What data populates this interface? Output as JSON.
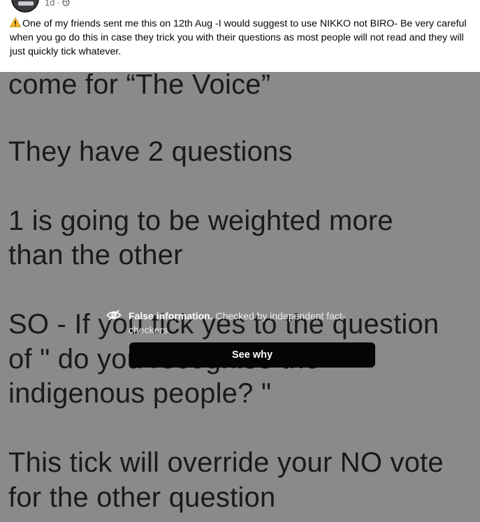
{
  "post": {
    "time_label": "1d",
    "separator": "·",
    "privacy_icon": "globe-icon",
    "caption": "One of my friends sent me this on 12th Aug -I would suggest to use NIKKO not BIRO- Be very careful when you go do this in case they trick you with their questions as most people will not read and they will just quickly tick whatever.",
    "caption_icon": "warning-icon"
  },
  "image": {
    "lines": [
      "come for “The Voice”",
      "They have 2 questions",
      "1 is going to be weighted more",
      "than the other",
      "SO  - If you tick yes to the question",
      "of \" do you recognise the",
      "indigenous people? \"",
      "This tick will override your NO vote",
      "for the other question"
    ]
  },
  "fact_check": {
    "title": "False information.",
    "text": "Checked by independent fact-checkers",
    "button_label": "See why",
    "icon": "eye-slash-icon"
  },
  "colors": {
    "overlay": "#8a8a8a",
    "button_bg": "#050505",
    "text": "#050505"
  }
}
